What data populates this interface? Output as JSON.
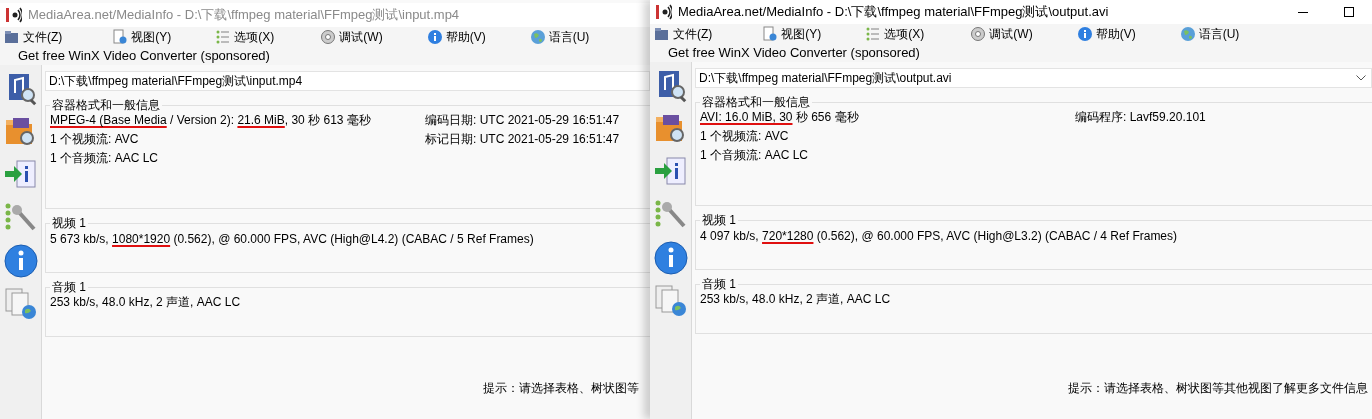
{
  "windows": [
    {
      "active": false,
      "caption_buttons_visible": false,
      "title": "MediaArea.net/MediaInfo - D:\\下载\\ffmpeg material\\FFmpeg测试\\input.mp4",
      "menu": [
        {
          "label": "文件(Z)"
        },
        {
          "label": "视图(Y)"
        },
        {
          "label": "选项(X)"
        },
        {
          "label": "调试(W)"
        },
        {
          "label": "帮助(V)"
        },
        {
          "label": "语言(U)"
        }
      ],
      "sponsor": "Get free WinX Video Converter (sponsored)",
      "path": "D:\\下载\\ffmpeg material\\FFmpeg测试\\input.mp4",
      "dropdown_visible": false,
      "sections": [
        {
          "heading": "容器格式和一般信息",
          "lines": [
            [
              {
                "text": "MPEG-4 (Base Media",
                "underlined": true
              },
              {
                "text": " / Version 2): ",
                "underlined": false
              },
              {
                "text": "21.6 MiB",
                "underlined": true
              },
              {
                "text": ", 30 秒 613 毫秒",
                "underlined": false
              }
            ],
            [
              {
                "text": "1 个视频流: AVC",
                "underlined": false
              }
            ],
            [
              {
                "text": "1 个音频流: AAC LC",
                "underlined": false
              }
            ]
          ],
          "side_lines": [
            "编码日期: UTC 2021-05-29 16:51:47",
            "标记日期: UTC 2021-05-29 16:51:47"
          ]
        },
        {
          "heading": "视频 1",
          "lines": [
            [
              {
                "text": "5 673 kb/s, ",
                "underlined": false
              },
              {
                "text": "1080*1920",
                "underlined": true
              },
              {
                "text": " (0.562), @ 60.000 FPS, AVC (High@L4.2) (CABAC / 5 Ref Frames)",
                "underlined": false
              }
            ]
          ]
        },
        {
          "heading": "音频 1",
          "lines": [
            [
              {
                "text": "253 kb/s, 48.0 kHz, 2 声道, AAC LC",
                "underlined": false
              }
            ]
          ]
        }
      ],
      "hint": "提示：请选择表格、树状图等"
    },
    {
      "active": true,
      "caption_buttons_visible": true,
      "title": "MediaArea.net/MediaInfo - D:\\下载\\ffmpeg material\\FFmpeg测试\\output.avi",
      "menu": [
        {
          "label": "文件(Z)"
        },
        {
          "label": "视图(Y)"
        },
        {
          "label": "选项(X)"
        },
        {
          "label": "调试(W)"
        },
        {
          "label": "帮助(V)"
        },
        {
          "label": "语言(U)"
        }
      ],
      "sponsor": "Get free WinX Video Converter (sponsored)",
      "path": "D:\\下载\\ffmpeg material\\FFmpeg测试\\output.avi",
      "dropdown_visible": true,
      "sections": [
        {
          "heading": "容器格式和一般信息",
          "lines": [
            [
              {
                "text": "AVI: 16.0 MiB, 30",
                "underlined": true
              },
              {
                "text": " 秒 656 毫秒",
                "underlined": false
              }
            ],
            [
              {
                "text": "1 个视频流: AVC",
                "underlined": false
              }
            ],
            [
              {
                "text": "1 个音频流: AAC LC",
                "underlined": false
              }
            ]
          ],
          "side_lines": [
            "编码程序: Lavf59.20.101"
          ]
        },
        {
          "heading": "视频 1",
          "lines": [
            [
              {
                "text": "4 097 kb/s, ",
                "underlined": false
              },
              {
                "text": "720*1280",
                "underlined": true
              },
              {
                "text": " (0.562), @ 60.000 FPS, AVC (High@L3.2) (CABAC / 4 Ref Frames)",
                "underlined": false
              }
            ]
          ]
        },
        {
          "heading": "音频 1",
          "lines": [
            [
              {
                "text": "253 kb/s, 48.0 kHz, 2 声道, AAC LC",
                "underlined": false
              }
            ]
          ]
        }
      ],
      "hint": "提示：请选择表格、树状图等其他视图了解更多文件信息"
    }
  ]
}
